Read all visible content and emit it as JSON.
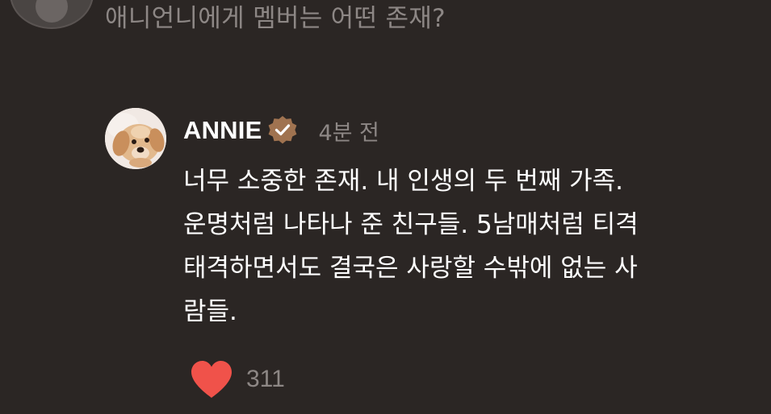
{
  "question": {
    "text": "애니언니에게 멤버는 어떤 존재?"
  },
  "reply": {
    "author": "ANNIE",
    "verified_icon": "verified-badge-icon",
    "timestamp": "4분 전",
    "body_lines": [
      "너무 소중한 존재. 내 인생의 두 번째 가족.",
      "운명처럼 나타나 준 친구들. 5남매처럼 티격",
      "태격하면서도 결국은 사랑할 수밖에 없는 사",
      "람들."
    ],
    "likes": "311"
  },
  "colors": {
    "background": "#2b2624",
    "muted_text": "#8d8785",
    "verified_badge": "#a07350",
    "heart": "#f0524a"
  }
}
